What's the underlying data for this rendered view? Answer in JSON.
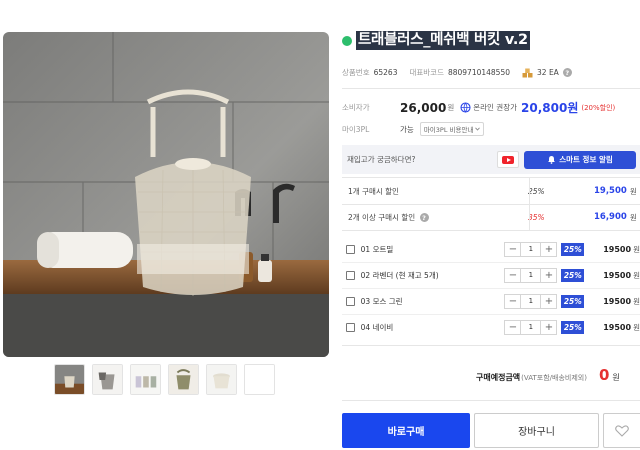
{
  "product": {
    "title": "트래블러스_메쉬백 버킷 v.2",
    "code_label": "상품번호",
    "code": "65263",
    "barcode_label": "대표바코드",
    "barcode": "8809710148550",
    "stock": "32 EA",
    "status_color": "#2dbe6c"
  },
  "pricing": {
    "retail_label": "소비자가",
    "retail_price": "26,000",
    "won": "원",
    "online_label": "온라인 권장가",
    "online_price": "20,800원",
    "discount": "(20%할인)"
  },
  "third_party": {
    "label": "마이3PL",
    "status": "가능",
    "select_value": "마이3PL 비용안내"
  },
  "restock": {
    "question": "재입고가 궁금하다면?",
    "smart_button": "스마트 정보 알림"
  },
  "tiers": [
    {
      "name": "1개 구매시 할인",
      "rate": "25%",
      "price": "19,500",
      "won": "원"
    },
    {
      "name": "2개 이상 구매시 할인",
      "rate": "35%",
      "price": "16,900",
      "won": "원"
    }
  ],
  "options": [
    {
      "name": "01 오트밀",
      "qty": "1",
      "rate": "25%",
      "price": "19500",
      "won": "원"
    },
    {
      "name": "02 라벤더 (현 재고 5개)",
      "qty": "1",
      "rate": "25%",
      "price": "19500",
      "won": "원"
    },
    {
      "name": "03 모스 그린",
      "qty": "1",
      "rate": "25%",
      "price": "19500",
      "won": "원"
    },
    {
      "name": "04 네이비",
      "qty": "1",
      "rate": "25%",
      "price": "19500",
      "won": "원"
    }
  ],
  "total": {
    "label": "구매예정금액",
    "note": "(VAT포함/배송비제외)",
    "value": "0",
    "won": "원"
  },
  "actions": {
    "buy_now": "바로구매",
    "cart": "장바구니"
  },
  "colors": {
    "accent": "#2e4fd6",
    "price_blue": "#2a44e8",
    "sale_red": "#e53030"
  },
  "icons": {
    "status": "green-dot-icon",
    "stock": "boxes-icon",
    "online": "globe-icon",
    "youtube": "youtube-icon",
    "smart": "bell-icon",
    "wish": "heart-icon"
  }
}
